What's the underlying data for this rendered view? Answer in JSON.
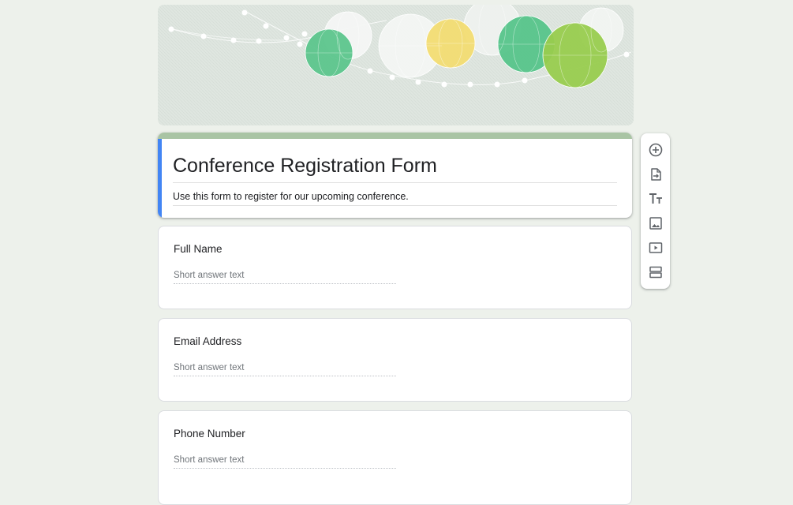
{
  "header": {
    "banner_theme": "paper lanterns",
    "colors": {
      "background": "#edf1eb",
      "banner": "#dfe6e0",
      "accent_top": "#a9c4a4",
      "accent_left": "#4285f4"
    }
  },
  "form": {
    "title": "Conference Registration Form",
    "description": "Use this form to register for our upcoming conference."
  },
  "questions": [
    {
      "title": "Full Name",
      "placeholder": "Short answer text"
    },
    {
      "title": "Email Address",
      "placeholder": "Short answer text"
    },
    {
      "title": "Phone Number",
      "placeholder": "Short answer text"
    }
  ],
  "toolbar": {
    "items": [
      {
        "icon": "add-circle-icon",
        "tooltip": "Add question"
      },
      {
        "icon": "import-questions-icon",
        "tooltip": "Import questions"
      },
      {
        "icon": "title-text-icon",
        "tooltip": "Add title and description"
      },
      {
        "icon": "image-icon",
        "tooltip": "Add image"
      },
      {
        "icon": "video-icon",
        "tooltip": "Add video"
      },
      {
        "icon": "section-icon",
        "tooltip": "Add section"
      }
    ]
  }
}
